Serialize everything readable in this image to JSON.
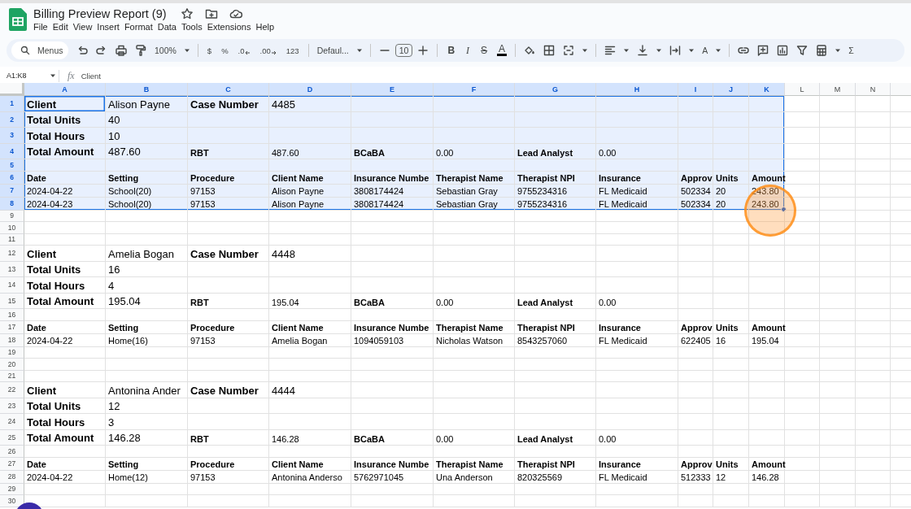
{
  "document": {
    "title": "Billing Preview Report (9)"
  },
  "menu": [
    "File",
    "Edit",
    "View",
    "Insert",
    "Format",
    "Data",
    "Tools",
    "Extensions",
    "Help"
  ],
  "toolbar": {
    "search": {
      "placeholder": "Menus"
    },
    "zoom": "100%",
    "number_formats": [
      {
        "kind": "currency",
        "label": "$"
      },
      {
        "kind": "percent",
        "label": "%"
      },
      {
        "kind": "decrease",
        "label": ".0"
      },
      {
        "kind": "increase",
        "label": ".00"
      },
      {
        "kind": "more",
        "label": "123"
      }
    ],
    "font": "Defaul...",
    "font_size": "10",
    "text_styles": [
      {
        "kind": "bold",
        "label": "B"
      },
      {
        "kind": "italic",
        "label": "I"
      },
      {
        "kind": "strike",
        "label": "S"
      },
      {
        "kind": "color",
        "label": "A"
      }
    ],
    "rotate": "A",
    "functions": "Σ"
  },
  "formula_bar": {
    "name_box": "A1:K8",
    "fx": "fx",
    "value": "Client"
  },
  "sheet": {
    "columns": [
      {
        "label": "A",
        "selected": true
      },
      {
        "label": "B",
        "selected": true
      },
      {
        "label": "C",
        "selected": true
      },
      {
        "label": "D",
        "selected": true
      },
      {
        "label": "E",
        "selected": true
      },
      {
        "label": "F",
        "selected": true
      },
      {
        "label": "G",
        "selected": true
      },
      {
        "label": "H",
        "selected": true
      },
      {
        "label": "I",
        "selected": true
      },
      {
        "label": "J",
        "selected": true
      },
      {
        "label": "K",
        "selected": true
      },
      {
        "label": "L",
        "selected": false
      },
      {
        "label": "M",
        "selected": false
      },
      {
        "label": "N",
        "selected": false
      }
    ],
    "rows": [
      {
        "number": "1",
        "kind": "title",
        "selected": true,
        "active": true,
        "cells": [
          "Client",
          "Alison Payne",
          "Case Number",
          "4485"
        ]
      },
      {
        "number": "2",
        "kind": "total",
        "selected": true,
        "active": false,
        "cells": [
          "Total Units",
          "40"
        ]
      },
      {
        "number": "3",
        "kind": "total",
        "selected": true,
        "active": false,
        "cells": [
          "Total Hours",
          "10"
        ]
      },
      {
        "number": "4",
        "kind": "amount",
        "selected": true,
        "active": false,
        "cells": [
          "Total Amount",
          "487.60",
          "RBT",
          "487.60",
          "BCaBA",
          "0.00",
          "Lead Analyst",
          "0.00"
        ]
      },
      {
        "number": "5",
        "kind": "blank",
        "selected": true,
        "active": false,
        "cells": []
      },
      {
        "number": "6",
        "kind": "header",
        "selected": true,
        "active": false,
        "cells": [
          "Date",
          "Setting",
          "Procedure",
          "Client Name",
          "Insurance Numbe",
          "Therapist Name",
          "Therapist NPI",
          "Insurance",
          "Approv",
          "Units",
          "Amount"
        ]
      },
      {
        "number": "7",
        "kind": "data",
        "selected": true,
        "active": false,
        "cells": [
          "2024-04-22",
          "School(20)",
          "97153",
          "Alison Payne",
          "3808174424",
          "Sebastian Gray",
          "9755234316",
          "FL Medicaid",
          "502334",
          "20",
          "243.80"
        ]
      },
      {
        "number": "8",
        "kind": "data",
        "selected": true,
        "active": false,
        "cells": [
          "2024-04-23",
          "School(20)",
          "97153",
          "Alison Payne",
          "3808174424",
          "Sebastian Gray",
          "9755234316",
          "FL Medicaid",
          "502334",
          "20",
          "243.80"
        ]
      },
      {
        "number": "9",
        "kind": "blank",
        "selected": false,
        "active": false,
        "cells": []
      },
      {
        "number": "10",
        "kind": "blank",
        "selected": false,
        "active": false,
        "cells": []
      },
      {
        "number": "11",
        "kind": "blank",
        "selected": false,
        "active": false,
        "cells": []
      },
      {
        "number": "12",
        "kind": "title",
        "selected": false,
        "active": false,
        "cells": [
          "Client",
          "Amelia Bogan",
          "Case Number",
          "4448"
        ]
      },
      {
        "number": "13",
        "kind": "total",
        "selected": false,
        "active": false,
        "cells": [
          "Total Units",
          "16"
        ]
      },
      {
        "number": "14",
        "kind": "total",
        "selected": false,
        "active": false,
        "cells": [
          "Total Hours",
          "4"
        ]
      },
      {
        "number": "15",
        "kind": "amount",
        "selected": false,
        "active": false,
        "cells": [
          "Total Amount",
          "195.04",
          "RBT",
          "195.04",
          "BCaBA",
          "0.00",
          "Lead Analyst",
          "0.00"
        ]
      },
      {
        "number": "16",
        "kind": "blank",
        "selected": false,
        "active": false,
        "cells": []
      },
      {
        "number": "17",
        "kind": "header",
        "selected": false,
        "active": false,
        "cells": [
          "Date",
          "Setting",
          "Procedure",
          "Client Name",
          "Insurance Numbe",
          "Therapist Name",
          "Therapist NPI",
          "Insurance",
          "Approv",
          "Units",
          "Amount"
        ]
      },
      {
        "number": "18",
        "kind": "data",
        "selected": false,
        "active": false,
        "cells": [
          "2024-04-22",
          "Home(16)",
          "97153",
          "Amelia Bogan",
          "1094059103",
          "Nicholas Watson",
          "8543257060",
          "FL Medicaid",
          "622405",
          "16",
          "195.04"
        ]
      },
      {
        "number": "19",
        "kind": "blank",
        "selected": false,
        "active": false,
        "cells": []
      },
      {
        "number": "20",
        "kind": "blank",
        "selected": false,
        "active": false,
        "cells": []
      },
      {
        "number": "21",
        "kind": "blank",
        "selected": false,
        "active": false,
        "cells": []
      },
      {
        "number": "22",
        "kind": "title",
        "selected": false,
        "active": false,
        "cells": [
          "Client",
          "Antonina Ander",
          "Case Number",
          "4444"
        ]
      },
      {
        "number": "23",
        "kind": "total",
        "selected": false,
        "active": false,
        "cells": [
          "Total Units",
          "12"
        ]
      },
      {
        "number": "24",
        "kind": "total",
        "selected": false,
        "active": false,
        "cells": [
          "Total Hours",
          "3"
        ]
      },
      {
        "number": "25",
        "kind": "amount",
        "selected": false,
        "active": false,
        "cells": [
          "Total Amount",
          "146.28",
          "RBT",
          "146.28",
          "BCaBA",
          "0.00",
          "Lead Analyst",
          "0.00"
        ]
      },
      {
        "number": "26",
        "kind": "blank",
        "selected": false,
        "active": false,
        "cells": []
      },
      {
        "number": "27",
        "kind": "header",
        "selected": false,
        "active": false,
        "cells": [
          "Date",
          "Setting",
          "Procedure",
          "Client Name",
          "Insurance Numbe",
          "Therapist Name",
          "Therapist NPI",
          "Insurance",
          "Approv",
          "Units",
          "Amount"
        ]
      },
      {
        "number": "28",
        "kind": "data",
        "selected": false,
        "active": false,
        "cells": [
          "2024-04-22",
          "Home(12)",
          "97153",
          "Antonina Anderso",
          "5762971045",
          "Una Anderson",
          "820325569",
          "FL Medicaid",
          "512333",
          "12",
          "146.28"
        ]
      },
      {
        "number": "29",
        "kind": "blank",
        "selected": false,
        "active": false,
        "cells": []
      },
      {
        "number": "30",
        "kind": "blank",
        "selected": false,
        "active": false,
        "cells": []
      }
    ]
  },
  "overlays": {
    "click_marker": true,
    "floating_button": true
  }
}
